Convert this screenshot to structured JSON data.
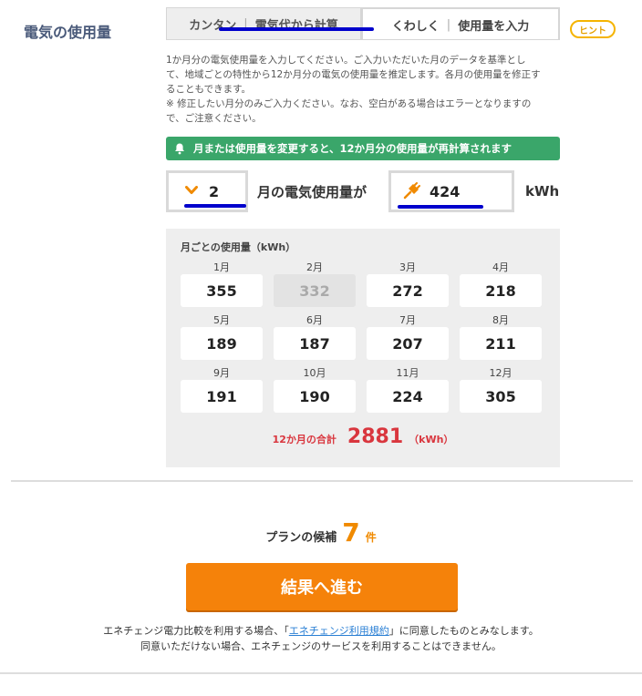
{
  "section": {
    "label": "電気の使用量"
  },
  "tabs": {
    "simple": "カンタン",
    "by_bill": "電気代から計算",
    "detail": "くわしく",
    "by_usage": "使用量を入力",
    "separator": "|"
  },
  "hint": "ヒント",
  "description": {
    "line1": "1か月分の電気使用量を入力してください。ご入力いただいた月のデータを基準とし",
    "line2": "て、地域ごとの特性から12か月分の電気の使用量を推定します。各月の使用量を修正す",
    "line3": "ることもできます。",
    "line4": "※ 修正したい月分のみご入力ください。なお、空白がある場合はエラーとなりますの",
    "line5": "で、ご注意ください。"
  },
  "notice": "月または使用量を変更すると、12か月分の使用量が再計算されます",
  "input": {
    "month": "2",
    "label": "月の電気使用量が",
    "usage": "424",
    "unit": "kWh"
  },
  "monthly": {
    "title": "月ごとの使用量（kWh）",
    "months": [
      {
        "label": "1月",
        "value": "355"
      },
      {
        "label": "2月",
        "value": "332"
      },
      {
        "label": "3月",
        "value": "272"
      },
      {
        "label": "4月",
        "value": "218"
      },
      {
        "label": "5月",
        "value": "189"
      },
      {
        "label": "6月",
        "value": "187"
      },
      {
        "label": "7月",
        "value": "207"
      },
      {
        "label": "8月",
        "value": "211"
      },
      {
        "label": "9月",
        "value": "191"
      },
      {
        "label": "10月",
        "value": "190"
      },
      {
        "label": "11月",
        "value": "224"
      },
      {
        "label": "12月",
        "value": "305"
      }
    ],
    "total_label": "12か月の合計",
    "total_value": "2881",
    "total_unit": "（kWh）"
  },
  "candidates": {
    "label": "プランの候補",
    "count": "7",
    "unit": "件"
  },
  "go_button": "結果へ進む",
  "terms": {
    "pre": "エネチェンジ電力比較を利用する場合、「",
    "link": "エネチェンジ利用規約",
    "post": "」に同意したものとみなします。",
    "line2": "同意いただけない場合、エネチェンジのサービスを利用することはできません。"
  },
  "colors": {
    "accent": "#f5820a",
    "notice": "#3aa66a",
    "total": "#d9363e",
    "hint": "#f5b400"
  }
}
